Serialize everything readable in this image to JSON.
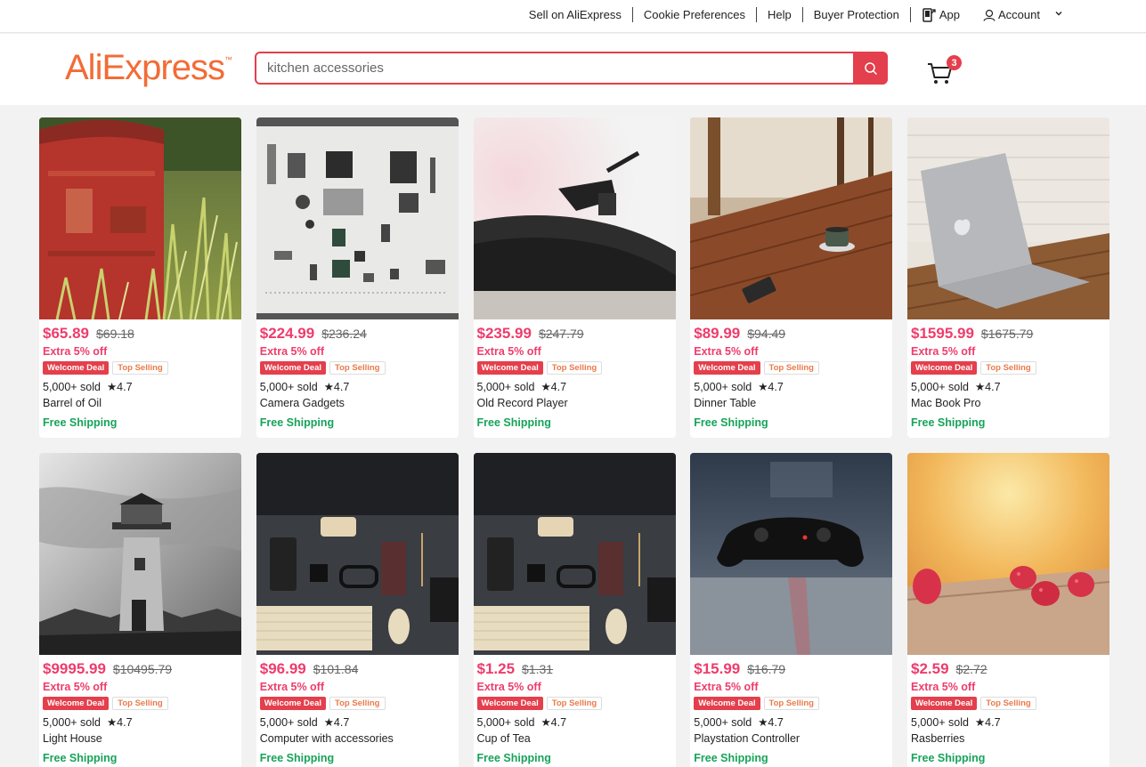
{
  "topnav": {
    "sell": "Sell on AliExpress",
    "cookie": "Cookie Preferences",
    "help": "Help",
    "buyer_protection": "Buyer Protection",
    "app": "App",
    "account": "Account"
  },
  "header": {
    "logo": "AliExpress",
    "search_value": "kitchen accessories",
    "cart_count": "3"
  },
  "colors": {
    "accent": "#e43f4c",
    "price": "#ee3c6c",
    "shipping": "#17a35a",
    "logo": "#f26c36"
  },
  "products": [
    {
      "price": "$65.89",
      "old_price": "$69.18",
      "extra": "Extra 5% off",
      "badge1": "Welcome Deal",
      "badge2": "Top Selling",
      "sold": "5,000+ sold",
      "rating": "★4.7",
      "name": "Barrel of Oil",
      "shipping": "Free Shipping"
    },
    {
      "price": "$224.99",
      "old_price": "$236.24",
      "extra": "Extra 5% off",
      "badge1": "Welcome Deal",
      "badge2": "Top Selling",
      "sold": "5,000+ sold",
      "rating": "★4.7",
      "name": "Camera Gadgets",
      "shipping": "Free Shipping"
    },
    {
      "price": "$235.99",
      "old_price": "$247.79",
      "extra": "Extra 5% off",
      "badge1": "Welcome Deal",
      "badge2": "Top Selling",
      "sold": "5,000+ sold",
      "rating": "★4.7",
      "name": "Old Record Player",
      "shipping": "Free Shipping"
    },
    {
      "price": "$89.99",
      "old_price": "$94.49",
      "extra": "Extra 5% off",
      "badge1": "Welcome Deal",
      "badge2": "Top Selling",
      "sold": "5,000+ sold",
      "rating": "★4.7",
      "name": "Dinner Table",
      "shipping": "Free Shipping"
    },
    {
      "price": "$1595.99",
      "old_price": "$1675.79",
      "extra": "Extra 5% off",
      "badge1": "Welcome Deal",
      "badge2": "Top Selling",
      "sold": "5,000+ sold",
      "rating": "★4.7",
      "name": "Mac Book Pro",
      "shipping": "Free Shipping"
    },
    {
      "price": "$9995.99",
      "old_price": "$10495.79",
      "extra": "Extra 5% off",
      "badge1": "Welcome Deal",
      "badge2": "Top Selling",
      "sold": "5,000+ sold",
      "rating": "★4.7",
      "name": "Light House",
      "shipping": "Free Shipping"
    },
    {
      "price": "$96.99",
      "old_price": "$101.84",
      "extra": "Extra 5% off",
      "badge1": "Welcome Deal",
      "badge2": "Top Selling",
      "sold": "5,000+ sold",
      "rating": "★4.7",
      "name": "Computer with accessories",
      "shipping": "Free Shipping"
    },
    {
      "price": "$1.25",
      "old_price": "$1.31",
      "extra": "Extra 5% off",
      "badge1": "Welcome Deal",
      "badge2": "Top Selling",
      "sold": "5,000+ sold",
      "rating": "★4.7",
      "name": "Cup of Tea",
      "shipping": "Free Shipping"
    },
    {
      "price": "$15.99",
      "old_price": "$16.79",
      "extra": "Extra 5% off",
      "badge1": "Welcome Deal",
      "badge2": "Top Selling",
      "sold": "5,000+ sold",
      "rating": "★4.7",
      "name": "Playstation Controller",
      "shipping": "Free Shipping"
    },
    {
      "price": "$2.59",
      "old_price": "$2.72",
      "extra": "Extra 5% off",
      "badge1": "Welcome Deal",
      "badge2": "Top Selling",
      "sold": "5,000+ sold",
      "rating": "★4.7",
      "name": "Rasberries",
      "shipping": "Free Shipping"
    }
  ]
}
